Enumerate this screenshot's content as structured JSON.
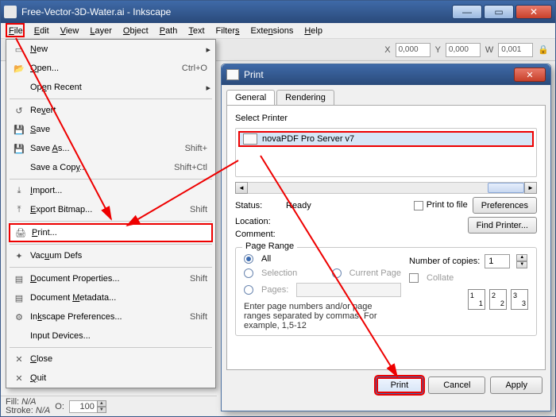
{
  "window": {
    "title": "Free-Vector-3D-Water.ai - Inkscape"
  },
  "menubar": [
    "File",
    "Edit",
    "View",
    "Layer",
    "Object",
    "Path",
    "Text",
    "Filters",
    "Extensions",
    "Help"
  ],
  "toolbar": {
    "x_label": "X",
    "x_val": "0,000",
    "y_label": "Y",
    "y_val": "0,000",
    "w_label": "W",
    "w_val": "0,001",
    "lock": "🔒"
  },
  "file_menu": {
    "new": "New",
    "open": "Open...",
    "open_sc": "Ctrl+O",
    "recent": "Open Recent",
    "revert": "Revert",
    "save": "Save",
    "save_as": "Save As...",
    "save_as_sc": "Shift+",
    "save_copy": "Save a Copy...",
    "save_copy_sc": "Shift+Ctl",
    "import": "Import...",
    "export": "Export Bitmap...",
    "export_sc": "Shift",
    "print": "Print...",
    "vacuum": "Vacuum Defs",
    "doc_props": "Document Properties...",
    "doc_props_sc": "Shift",
    "doc_meta": "Document Metadata...",
    "ink_prefs": "Inkscape Preferences...",
    "ink_prefs_sc": "Shift",
    "input_dev": "Input Devices...",
    "close": "Close",
    "quit": "Quit"
  },
  "status": {
    "fill_lbl": "Fill:",
    "fill_val": "N/A",
    "stroke_lbl": "Stroke:",
    "stroke_val": "N/A",
    "o_lbl": "O:",
    "o_val": "100"
  },
  "print": {
    "title": "Print",
    "tab_general": "General",
    "tab_rendering": "Rendering",
    "select_printer": "Select Printer",
    "printer_name": "novaPDF Pro Server v7",
    "status_lbl": "Status:",
    "status_val": "Ready",
    "location_lbl": "Location:",
    "comment_lbl": "Comment:",
    "print_to_file": "Print to file",
    "preferences": "Preferences",
    "find_printer": "Find Printer...",
    "page_range": "Page Range",
    "all": "All",
    "selection": "Selection",
    "current": "Current Page",
    "pages": "Pages:",
    "hint": "Enter page numbers and/or page ranges separated by commas.  For example, 1,5-12",
    "copies_lbl": "Number of copies:",
    "copies_val": "1",
    "collate": "Collate",
    "btn_print": "Print",
    "btn_cancel": "Cancel",
    "btn_apply": "Apply"
  }
}
